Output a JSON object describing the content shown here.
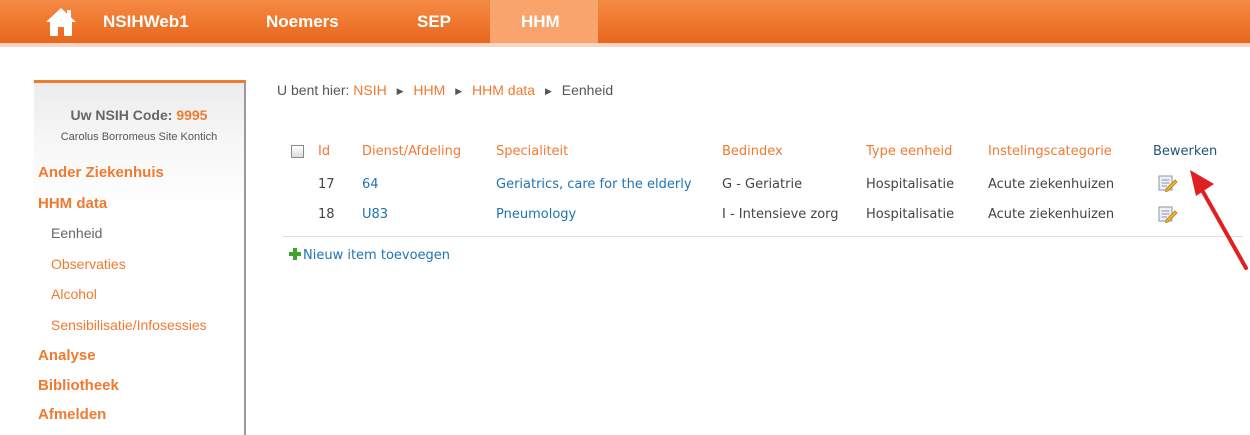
{
  "nav": {
    "home_icon": "house-icon",
    "items": [
      "NSIHWeb1",
      "Noemers",
      "SEP",
      "HHM"
    ],
    "active": "HHM"
  },
  "sidebar": {
    "code_label": "Uw NSIH Code:",
    "code_value": "9995",
    "site_name": "Carolus Borromeus Site Kontich",
    "links": {
      "ander": "Ander Ziekenhuis",
      "hhm_data": "HHM data",
      "eenheid": "Eenheid",
      "observaties": "Observaties",
      "alcohol": "Alcohol",
      "sensibilisatie": "Sensibilisatie/Infosessies",
      "analyse": "Analyse",
      "bibliotheek": "Bibliotheek",
      "afmelden": "Afmelden"
    }
  },
  "breadcrumb": {
    "prefix": "U bent hier:",
    "items": [
      "NSIH",
      "HHM",
      "HHM data",
      "Eenheid"
    ]
  },
  "table": {
    "headers": {
      "id": "Id",
      "dienst": "Dienst/Afdeling",
      "specialiteit": "Specialiteit",
      "bedindex": "Bedindex",
      "type": "Type eenheid",
      "instelling": "Instelingscategorie",
      "bewerken": "Bewerken"
    },
    "rows": [
      {
        "id": "17",
        "dienst": "64",
        "specialiteit": "Geriatrics, care for the elderly",
        "bedindex": "G - Geriatrie",
        "type": "Hospitalisatie",
        "instelling": "Acute ziekenhuizen"
      },
      {
        "id": "18",
        "dienst": "U83",
        "specialiteit": "Pneumology",
        "bedindex": "I - Intensieve zorg",
        "type": "Hospitalisatie",
        "instelling": "Acute ziekenhuizen"
      }
    ]
  },
  "add_item": "Nieuw item toevoegen",
  "colors": {
    "accent": "#f07a30",
    "link": "#1f74b3",
    "header_dark": "#23557a",
    "arrow": "#e02020"
  }
}
